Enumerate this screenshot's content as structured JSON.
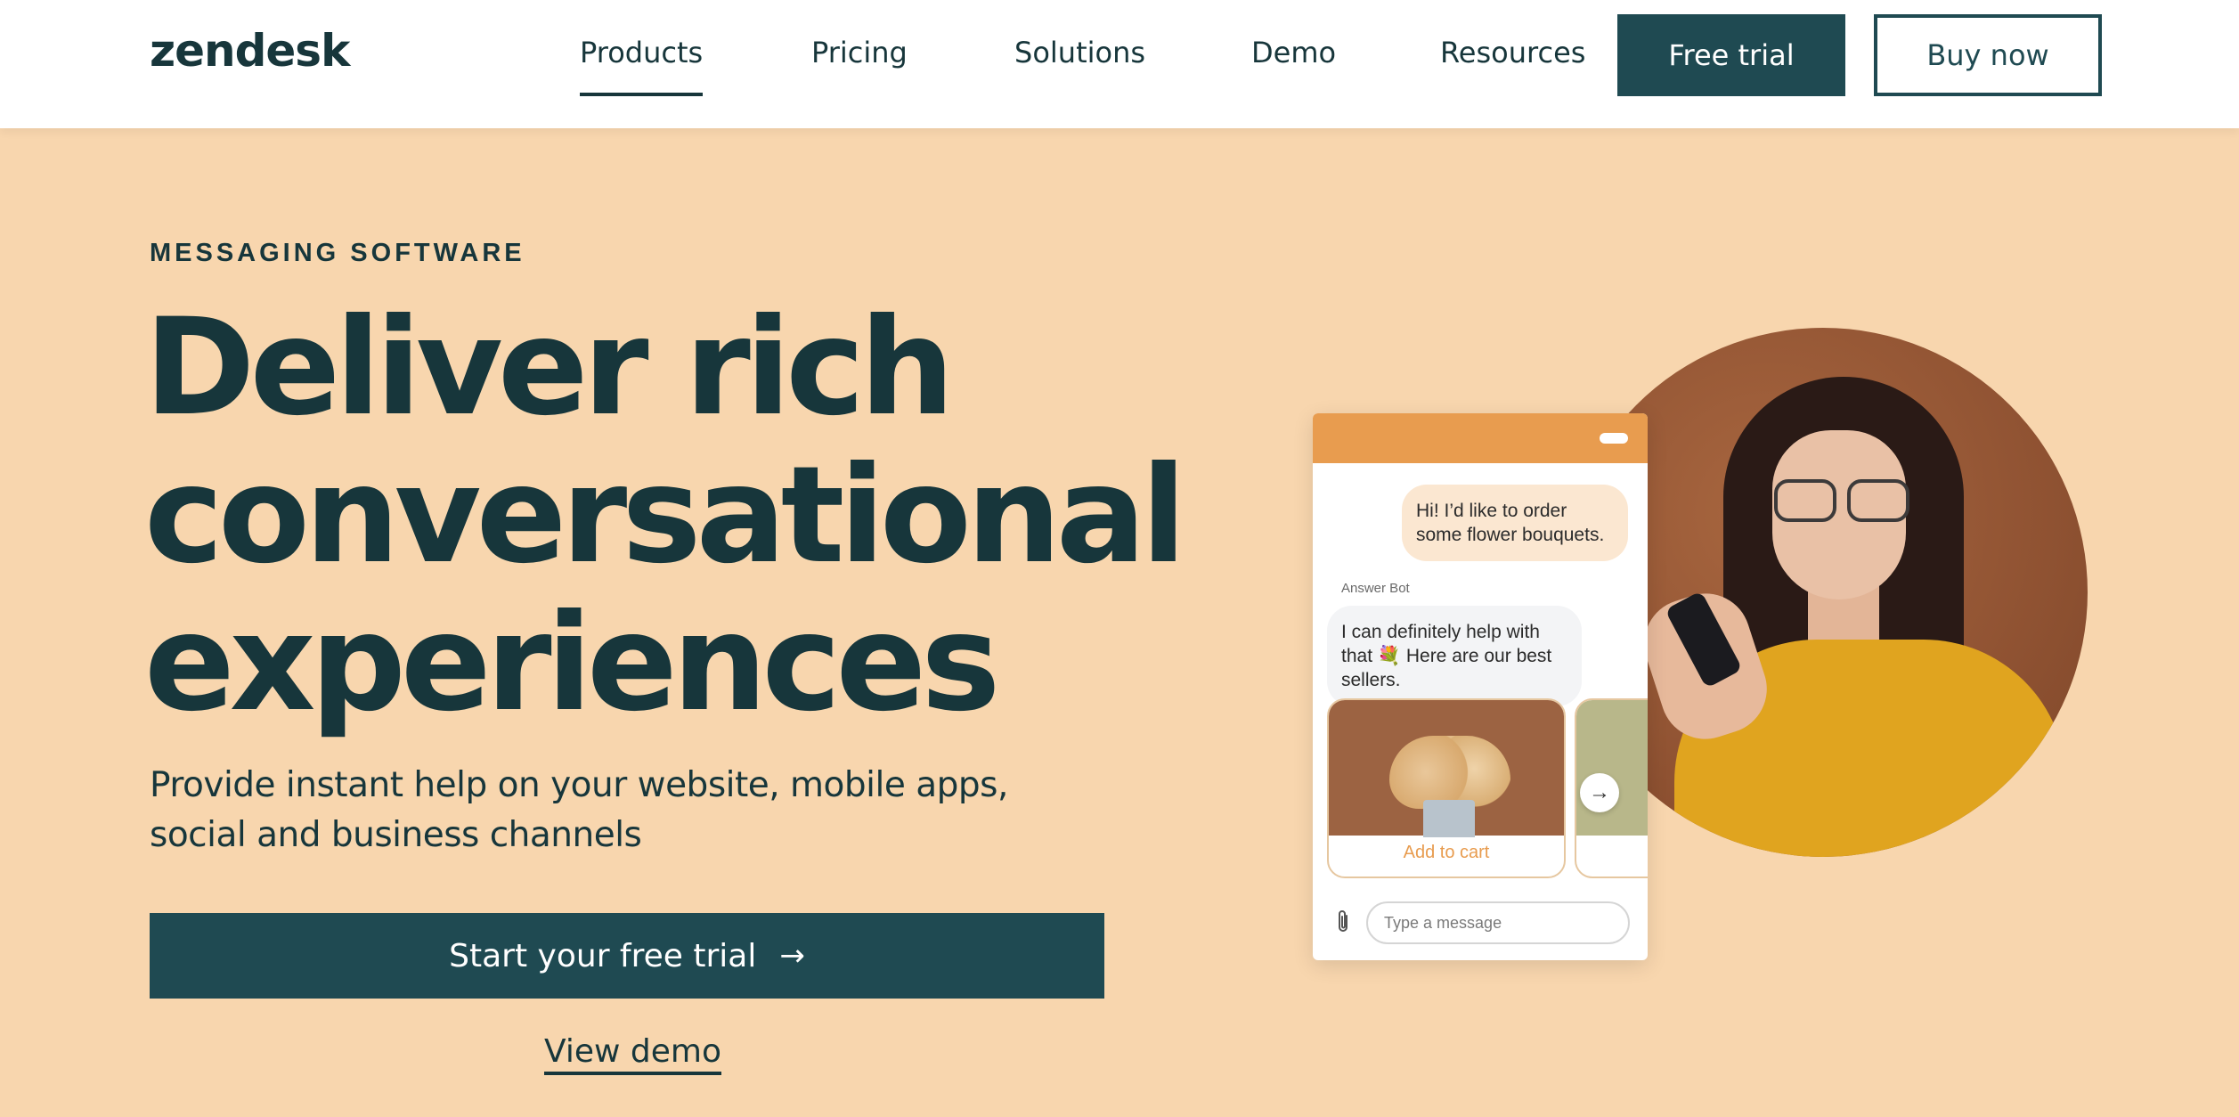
{
  "header": {
    "logo": "zendesk",
    "nav": [
      {
        "label": "Products",
        "active": true
      },
      {
        "label": "Pricing"
      },
      {
        "label": "Solutions"
      },
      {
        "label": "Demo"
      },
      {
        "label": "Resources"
      }
    ],
    "free_trial_label": "Free trial",
    "buy_now_label": "Buy now"
  },
  "hero": {
    "eyebrow": "MESSAGING SOFTWARE",
    "headline": [
      "Deliver rich",
      "conversational",
      "experiences"
    ],
    "subtitle": "Provide instant help on your website, mobile apps, social and business channels",
    "cta_label": "Start your free trial",
    "cta_icon": "arrow-right-icon",
    "view_demo_label": "View demo"
  },
  "chat_widget": {
    "user_message": "Hi! I’d like to order some flower bouquets.",
    "bot_label": "Answer Bot",
    "bot_message": "I can definitely help with that 💐 Here are our best sellers.",
    "card_action_label": "Add to cart",
    "input_placeholder": "Type a message"
  },
  "colors": {
    "hero_bg": "#f8d6ae",
    "dark_teal": "#1f4a52",
    "text": "#17363b",
    "widget_header": "#e89c4f"
  }
}
